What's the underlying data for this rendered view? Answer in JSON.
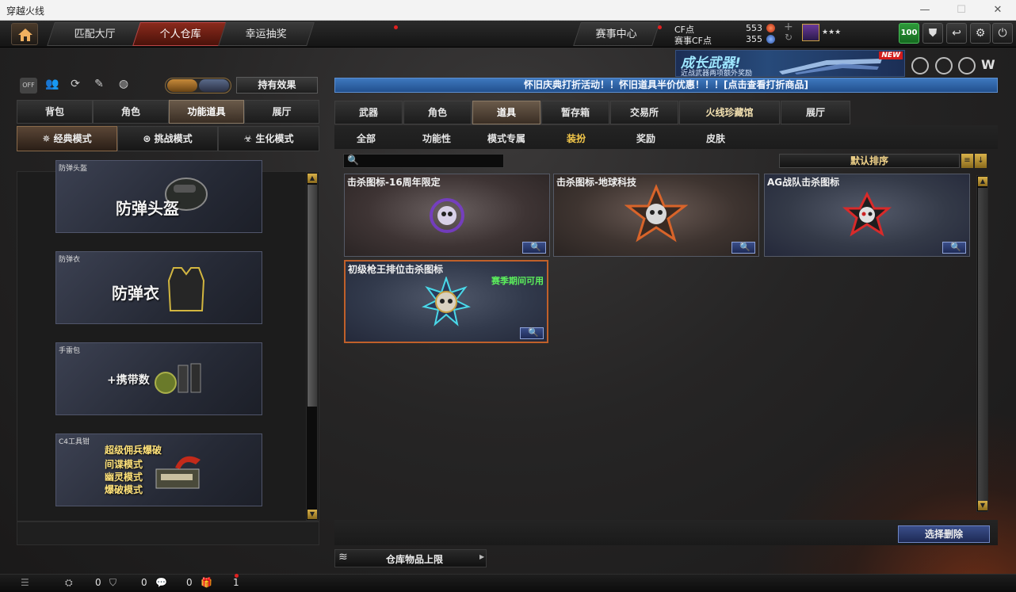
{
  "window": {
    "title": "穿越火线"
  },
  "topnav": {
    "tabs": [
      {
        "label": "匹配大厅",
        "active": false
      },
      {
        "label": "个人仓库",
        "active": true
      },
      {
        "label": "幸运抽奖",
        "active": false
      }
    ],
    "event_center": "赛事中心",
    "cf_label": "CF点",
    "cf_value": "553",
    "match_cf_label": "赛事CF点",
    "match_cf_value": "355",
    "level_badge": "100"
  },
  "banner": {
    "title": "成长武器!",
    "subtitle": "近战武器两项额外奖励",
    "badge": "NEW"
  },
  "left": {
    "effects_button": "持有效果",
    "tabs": [
      {
        "label": "背包",
        "active": false
      },
      {
        "label": "角色",
        "active": false
      },
      {
        "label": "功能道具",
        "active": true
      },
      {
        "label": "展厅",
        "active": false
      }
    ],
    "modes": [
      {
        "label": "经典模式",
        "active": true
      },
      {
        "label": "挑战模式",
        "active": false
      },
      {
        "label": "生化模式",
        "active": false
      }
    ],
    "cards": [
      {
        "tag": "防弹头盔",
        "text": "防弹头盔"
      },
      {
        "tag": "防弹衣",
        "text": "防弹衣"
      },
      {
        "tag": "手雷包",
        "text": "+携带数"
      },
      {
        "tag": "C4工具钳",
        "lines": [
          "超级佣兵爆破",
          "间谍模式",
          "幽灵模式",
          "爆破模式"
        ]
      }
    ]
  },
  "right": {
    "notice": "怀旧庆典打折活动！！怀旧道具半价优惠！！！[点击查看打折商品]",
    "tabs": [
      {
        "label": "武器",
        "active": false
      },
      {
        "label": "角色",
        "active": false
      },
      {
        "label": "道具",
        "active": true
      },
      {
        "label": "暂存箱",
        "active": false
      },
      {
        "label": "交易所",
        "active": false
      },
      {
        "label": "火线珍藏馆",
        "active": false
      },
      {
        "label": "展厅",
        "active": false
      }
    ],
    "subtabs": [
      {
        "label": "全部",
        "active": false
      },
      {
        "label": "功能性",
        "active": false
      },
      {
        "label": "模式专属",
        "active": false
      },
      {
        "label": "装扮",
        "active": true
      },
      {
        "label": "奖励",
        "active": false
      },
      {
        "label": "皮肤",
        "active": false
      }
    ],
    "search": {
      "placeholder": ""
    },
    "sort": "默认排序",
    "items": [
      {
        "name": "击杀图标-16周年限定",
        "note": ""
      },
      {
        "name": "击杀图标-地球科技",
        "note": ""
      },
      {
        "name": "AG战队击杀图标",
        "note": ""
      },
      {
        "name": "初级枪王排位击杀图标",
        "note": "赛季期间可用"
      }
    ],
    "delete_button": "选择删除",
    "capacity_button": "仓库物品上限"
  },
  "bottom": {
    "count1": "0",
    "count2": "0",
    "count3": "0",
    "count4": "1"
  },
  "colors": {
    "accent_red": "#8a2a1c",
    "notice_blue": "#2f62a8",
    "gold": "#f2d48a",
    "green_note": "#5cf05c"
  }
}
